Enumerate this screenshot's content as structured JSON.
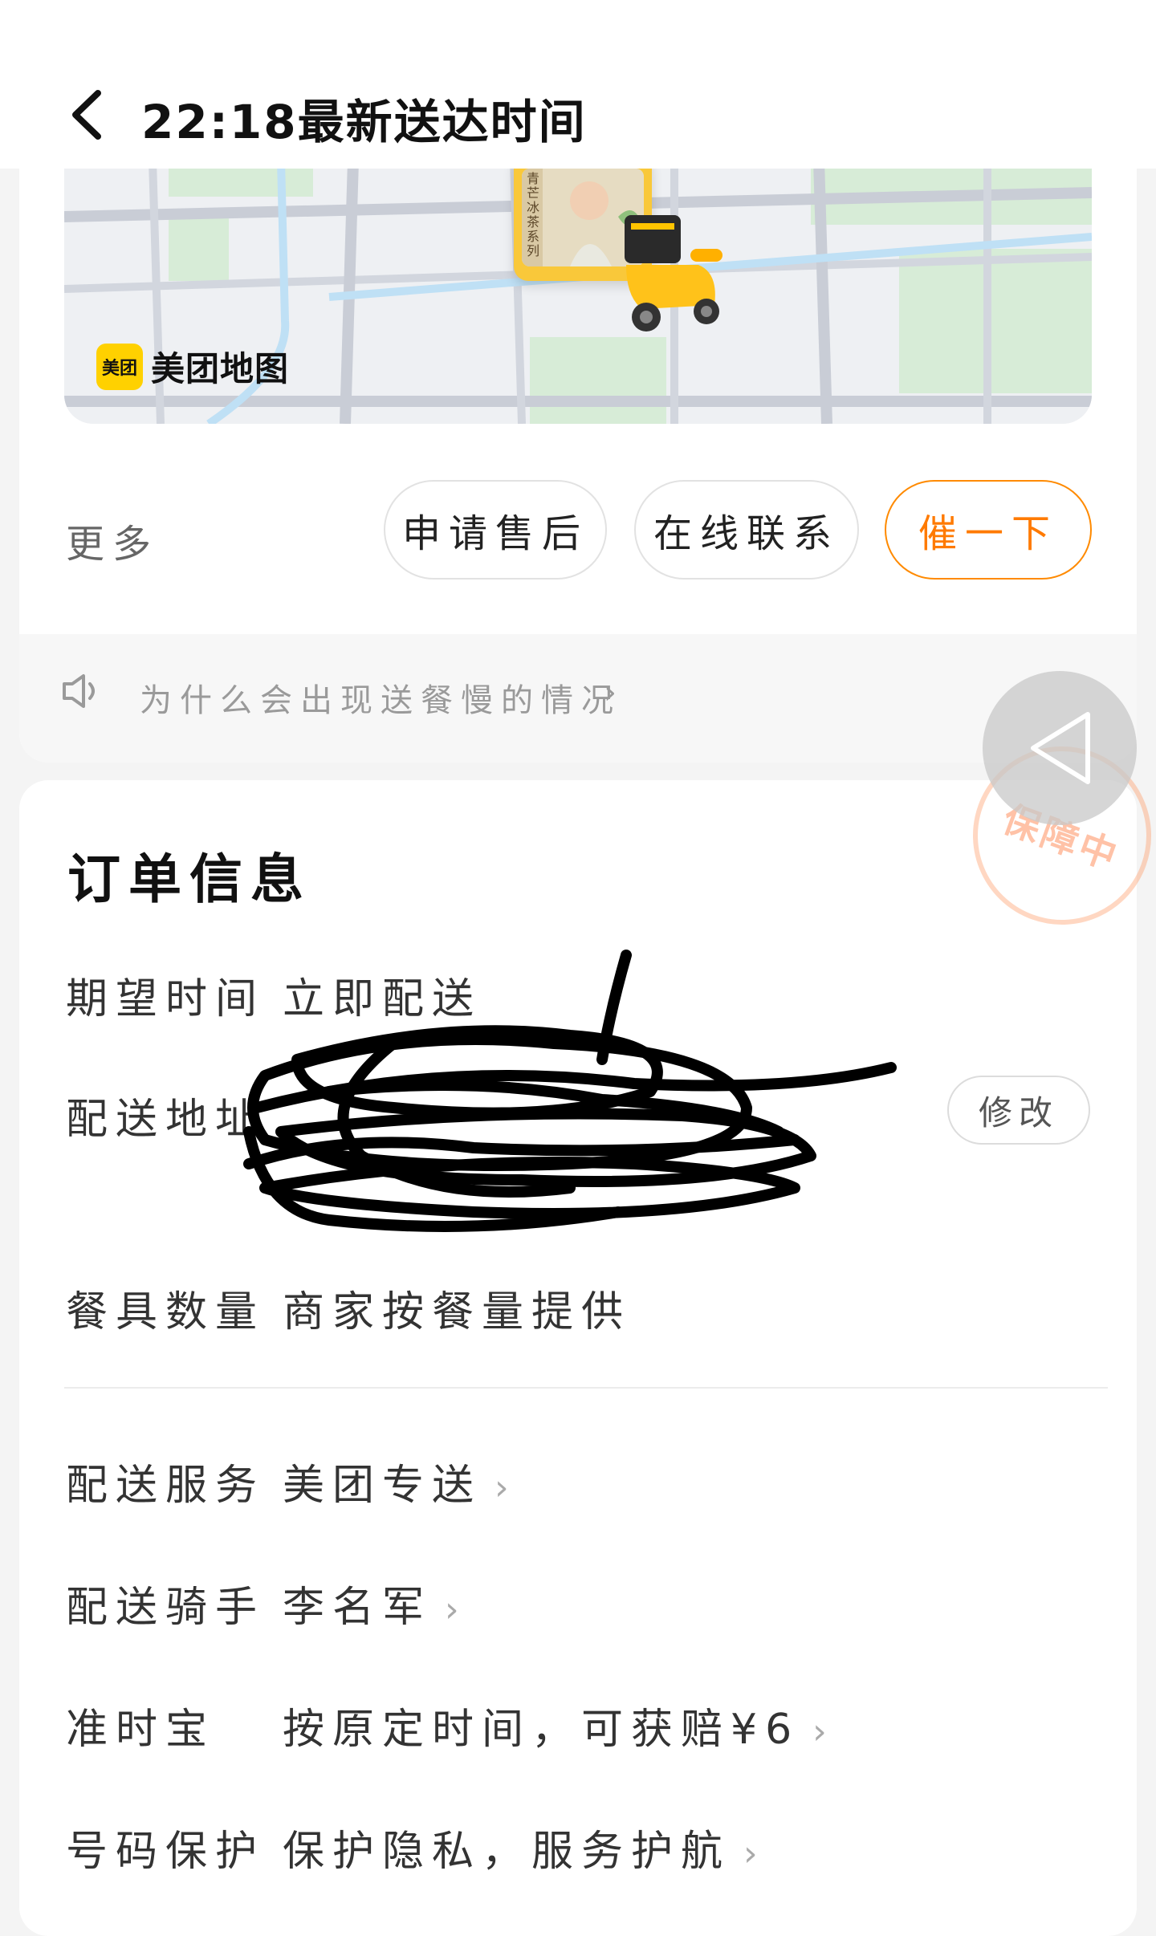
{
  "header": {
    "title": "22:18最新送达时间"
  },
  "map": {
    "logo_badge": "美团",
    "logo_text": "美团地图",
    "promo_text": "青芒冰茶系列"
  },
  "actions": {
    "more_label": "更多",
    "buttons": [
      "申请售后",
      "在线联系",
      "催一下"
    ]
  },
  "tip": {
    "text": "为什么会出现送餐慢的情况"
  },
  "stamp": {
    "text": "保障中"
  },
  "order": {
    "title": "订单信息",
    "rows": [
      {
        "label": "期望时间",
        "value": "立即配送"
      },
      {
        "label": "配送地址",
        "value": ""
      },
      {
        "label": "餐具数量",
        "value": "商家按餐量提供"
      },
      {
        "label": "配送服务",
        "value": "美团专送"
      },
      {
        "label": "配送骑手",
        "value": "李名军"
      },
      {
        "label": "准时宝",
        "value": "按原定时间，可获赔¥6"
      },
      {
        "label": "号码保护",
        "value": "保护隐私，服务护航"
      }
    ],
    "modify_label": "修改"
  },
  "colors": {
    "accent": "#ff7a00",
    "brand_yellow": "#ffd100"
  }
}
